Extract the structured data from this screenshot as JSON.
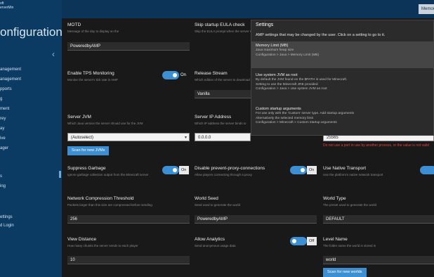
{
  "app": {
    "top_left_text": [
      "oft",
      "erverMin"
    ],
    "page_title": "onfiguration",
    "memory_pill": "Memory",
    "back_glyph": "‹"
  },
  "nav": {
    "items": [
      "anagement",
      "anagement",
      "pports",
      "g",
      "ment",
      "rey",
      "ay",
      "ive",
      "ager",
      "s",
      "ing",
      "ettings",
      "d Login"
    ]
  },
  "settings": {
    "motd": {
      "label": "MOTD",
      "desc": "Message of the day to display on the",
      "value": "PoweredbyAMP"
    },
    "enable_tps": {
      "label": "Enable TPS Monitoring",
      "desc": "Monitor the server's tick rate in AMP",
      "state": "On"
    },
    "server_ms": {
      "label": "Server JVM",
      "desc": "Which Java version the server should use for the JVM",
      "value": "(Autoselect)",
      "button": "Scan for new JVMs"
    },
    "suppress_garbage": {
      "label": "Suppress Garbage",
      "desc": "Ignore garbage collection output from the Minecraft server",
      "state": "On"
    },
    "network_compression": {
      "label": "Network Compression Threshold",
      "desc": "Packets larger than this size are compressed before sending",
      "value": "256"
    },
    "view_distance": {
      "label": "View Distance",
      "desc": "How many chunks the server sends to each player",
      "value": "10"
    },
    "skip_startup": {
      "label": "Skip startup EULA check",
      "desc": "Skip the EULA prompt when the server starts"
    },
    "release_stream": {
      "label": "Release Stream",
      "desc": "Which edition of the server to download",
      "value": "Vanilla"
    },
    "server_ip": {
      "label": "Server IP Address",
      "desc": "Which IP address the server binds to",
      "value": "0.0.0.0"
    },
    "disable_prevent_proxy": {
      "label": "Disable prevent-proxy-connections",
      "desc": "Allow players connecting through a proxy",
      "state": "On"
    },
    "world_seed": {
      "label": "World Seed",
      "desc": "Seed used to generate the world",
      "value": "PoweredbyAMP"
    },
    "allow_analytics": {
      "label": "Allow Analytics",
      "desc": "Send anonymous usage data",
      "state": "Off"
    },
    "level_type_value": "25565",
    "error_text": "Do not use a port in use by another process, or the value is not valid",
    "use_native_transport": {
      "label": "Use Native Transport",
      "desc": "Use the platform's native network transport"
    },
    "world_type": {
      "label": "World Type",
      "desc": "The preset used to generate the world",
      "value": "DEFAULT"
    },
    "level_name": {
      "label": "Level Name",
      "desc": "The folder name the world is stored in",
      "value": "world",
      "button": "Scan for new worlds"
    }
  },
  "tooltip": {
    "title": "Settings",
    "intro": "AMP settings that may be changed by the user. Click on a setting to go to it.",
    "entries": [
      {
        "name": "Memory Limit (MB)",
        "desc": [
          "Java maximum heap size",
          "Configuration > Java > Memory Limit (MB)"
        ]
      },
      {
        "name": "Use system JVM as root",
        "desc": [
          "By default the JVM found on the $PATH is used for Minecraft.",
          "Setting to use the Minecraft JRE provided",
          "Configuration > Java > Use system JVM as root"
        ]
      },
      {
        "name": "Custom startup arguments",
        "desc": [
          "For use only with the ‘Custom’ server type. Add startup arguments",
          "Alternatively the selected memory limit",
          "Configuration > Minecraft > Custom startup arguments"
        ]
      }
    ]
  }
}
